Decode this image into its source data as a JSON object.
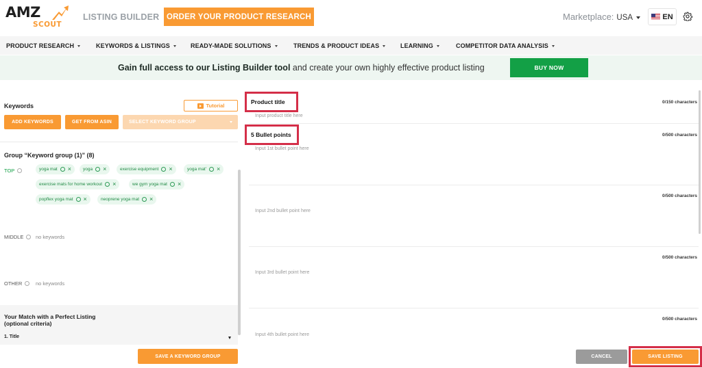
{
  "header": {
    "logo_amz": "AMZ",
    "logo_scout": "SCOUT",
    "app_title": "LISTING BUILDER",
    "order_button": "ORDER YOUR PRODUCT RESEARCH",
    "marketplace_label": "Marketplace:",
    "marketplace_value": "USA",
    "language": "EN",
    "accent_color": "#f99a33"
  },
  "nav": {
    "items": [
      {
        "label": "PRODUCT RESEARCH"
      },
      {
        "label": "KEYWORDS & LISTINGS"
      },
      {
        "label": "READY-MADE SOLUTIONS"
      },
      {
        "label": "TRENDS & PRODUCT IDEAS"
      },
      {
        "label": "LEARNING"
      },
      {
        "label": "COMPETITOR DATA ANALYSIS"
      }
    ]
  },
  "banner": {
    "bold_text": "Gain full access to our Listing Builder tool",
    "rest_text": " and create your own highly effective product listing",
    "buy_button": "BUY NOW",
    "buy_color": "#13a046"
  },
  "left": {
    "keywords_label": "Keywords",
    "tutorial_button": "Tutorial",
    "add_keywords_button": "ADD KEYWORDS",
    "get_from_asin_button": "GET FROM ASIN",
    "select_group_placeholder": "SELECT KEYWORD GROUP",
    "group_title": "Group “Keyword group (1)” (8)",
    "top_label": "TOP",
    "middle_label": "MIDDLE",
    "other_label": "OTHER",
    "no_keywords": "no keywords",
    "top_keywords": [
      "yoga mat",
      "yoga",
      "exercise equipment",
      "yoga mat'",
      "exercise mats for home workout",
      "we gym yoga mat",
      "popflex yoga mat",
      "neoprene yoga mat"
    ],
    "match_title_line1": "Your Match with a Perfect Listing",
    "match_title_line2": "(optional criteria)",
    "match_selected": "1. Title",
    "save_group_button": "SAVE A KEYWORD GROUP"
  },
  "right": {
    "product_title_label": "Product title",
    "product_title_counter": "0/150 characters",
    "product_title_placeholder": "Input product title here",
    "bullets_label": "5 Bullet points",
    "bullets": [
      {
        "placeholder": "Input 1st bullet point here",
        "counter": "0/500 characters"
      },
      {
        "placeholder": "Input 2nd bullet point here",
        "counter": "0/500 characters"
      },
      {
        "placeholder": "Input 3rd bullet point here",
        "counter": "0/500 characters"
      },
      {
        "placeholder": "Input 4th bullet point here",
        "counter": "0/500 characters"
      }
    ],
    "cancel_button": "CANCEL",
    "save_listing_button": "SAVE LISTING",
    "highlight_color": "#d42e48"
  }
}
